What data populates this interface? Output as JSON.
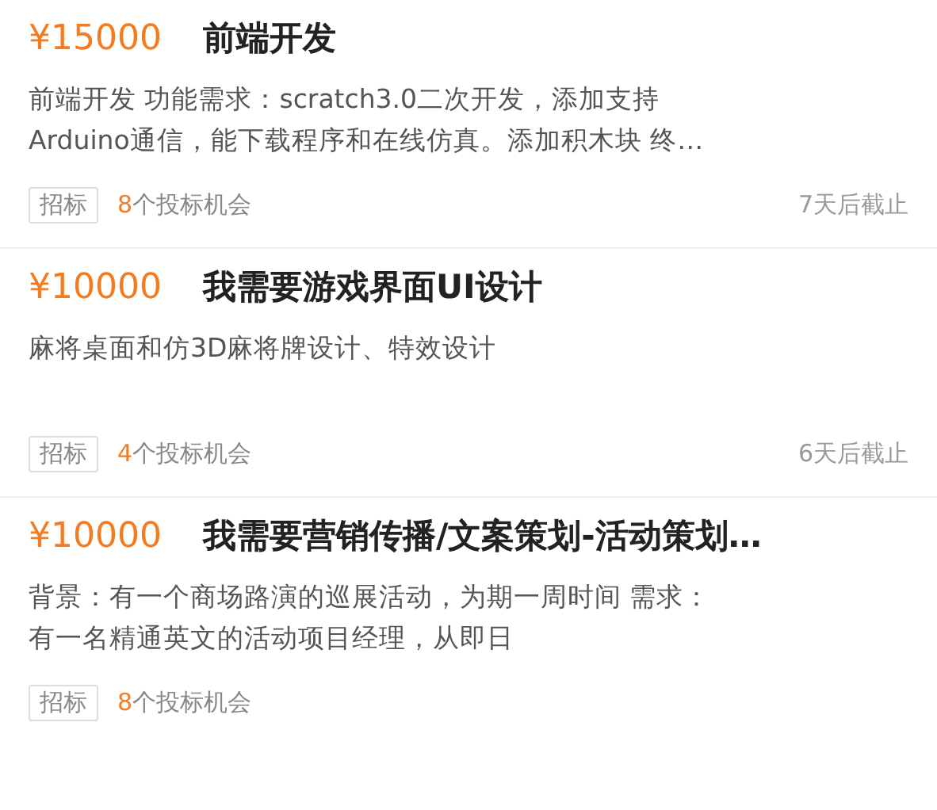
{
  "projects": [
    {
      "price": "¥15000",
      "title": "前端开发",
      "description_lines": [
        "前端开发 功能需求：scratch3.0二次开发，添加支持",
        "Arduino通信，能下载程序和在线仿真。添加积木块 终…"
      ],
      "tag": "招标",
      "bids": "8",
      "bids_label": "个投标机会",
      "deadline": "7天后截止"
    },
    {
      "price": "¥10000",
      "title": "我需要游戏界面UI设计",
      "description_lines": [
        "麻将桌面和仿3D麻将牌设计、特效设计"
      ],
      "tag": "招标",
      "bids": "4",
      "bids_label": "个投标机会",
      "deadline": "6天后截止"
    },
    {
      "price": "¥10000",
      "title": "我需要营销传播/文案策划-活动策划…",
      "description_lines": [
        "背景：有一个商场路演的巡展活动，为期一周时间 需求：",
        "有一名精通英文的活动项目经理，从即日"
      ],
      "tag": "招标",
      "bids": "8",
      "bids_label": "个投标机会"
    }
  ]
}
